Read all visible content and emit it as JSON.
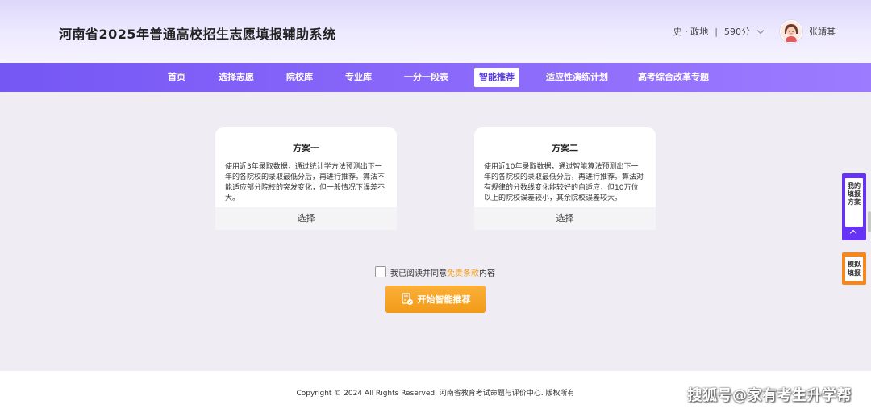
{
  "header": {
    "title": "河南省2025年普通高校招生志愿填报辅助系统",
    "subjects": "史 · 政地",
    "separator": "|",
    "score": "590分",
    "username": "张靖其"
  },
  "nav": {
    "items": [
      {
        "label": "首页"
      },
      {
        "label": "选择志愿"
      },
      {
        "label": "院校库"
      },
      {
        "label": "专业库"
      },
      {
        "label": "一分一段表"
      },
      {
        "label": "智能推荐",
        "active": true
      },
      {
        "label": "适应性演练计划"
      },
      {
        "label": "高考综合改革专题"
      }
    ]
  },
  "plans": [
    {
      "title": "方案一",
      "description": "使用近3年录取数据，通过统计学方法预测出下一年的各院校的录取最低分后，再进行推荐。算法不能适应部分院校的突发变化，但一般情况下误差不大。",
      "button": "选择"
    },
    {
      "title": "方案二",
      "description": "使用近10年录取数据，通过智能算法预测出下一年的各院校的录取最低分后，再进行推荐。算法对有规律的分数线变化能较好的自适应，但10万位以上的院校误差较小，其余院校误差较大。",
      "button": "选择"
    }
  ],
  "agreement": {
    "prefix": "我已阅读并同意",
    "link": "免责条款",
    "suffix": "内容"
  },
  "start_button": "开始智能推荐",
  "side": {
    "my_plan": "我的填报方案",
    "mock": "模拟填报"
  },
  "footer": {
    "copyright": "Copyright © 2024 All Rights Reserved. 河南省教育考试命题与评价中心. 版权所有"
  },
  "watermark": "搜狐号@家有考生升学帮",
  "colors": {
    "nav_bg": "#7f5ef8",
    "accent": "#f29a17",
    "side_plan": "#6632f4",
    "side_mock": "#f7871a"
  }
}
